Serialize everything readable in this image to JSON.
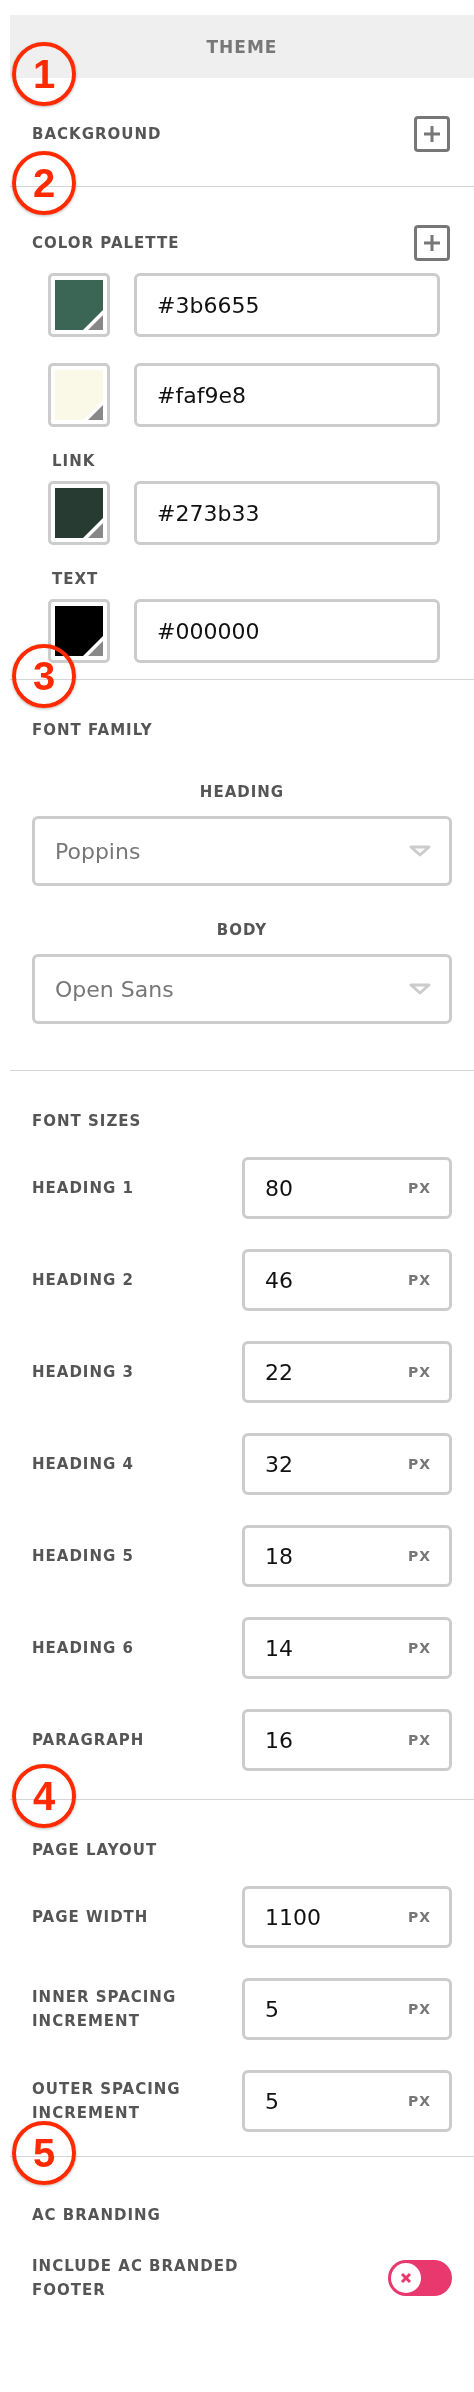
{
  "panel": {
    "title": "THEME"
  },
  "background": {
    "callout": "1",
    "label": "BACKGROUND"
  },
  "color_palette": {
    "callout": "2",
    "label": "COLOR PALETTE",
    "swatches": [
      {
        "value": "#3b6655",
        "color": "#3b6655"
      },
      {
        "value": "#faf9e8",
        "color": "#faf9e8"
      },
      {
        "label": "LINK",
        "value": "#273b33",
        "color": "#273b33"
      },
      {
        "label": "TEXT",
        "value": "#000000",
        "color": "#000000"
      }
    ]
  },
  "font_family": {
    "callout": "3",
    "label": "FONT FAMILY",
    "selects": [
      {
        "label": "HEADING",
        "value": "Poppins"
      },
      {
        "label": "BODY",
        "value": "Open Sans"
      }
    ]
  },
  "font_sizes": {
    "label": "FONT SIZES",
    "rows": [
      {
        "label": "HEADING 1",
        "value": "80",
        "unit": "PX"
      },
      {
        "label": "HEADING 2",
        "value": "46",
        "unit": "PX"
      },
      {
        "label": "HEADING 3",
        "value": "22",
        "unit": "PX"
      },
      {
        "label": "HEADING 4",
        "value": "32",
        "unit": "PX"
      },
      {
        "label": "HEADING 5",
        "value": "18",
        "unit": "PX"
      },
      {
        "label": "HEADING 6",
        "value": "14",
        "unit": "PX"
      },
      {
        "label": "PARAGRAPH",
        "value": "16",
        "unit": "PX"
      }
    ]
  },
  "page_layout": {
    "callout": "4",
    "label": "PAGE LAYOUT",
    "rows": [
      {
        "label": "PAGE WIDTH",
        "value": "1100",
        "unit": "PX"
      },
      {
        "label": "INNER SPACING INCREMENT",
        "value": "5",
        "unit": "PX"
      },
      {
        "label": "OUTER SPACING INCREMENT",
        "value": "5",
        "unit": "PX"
      }
    ]
  },
  "ac_branding": {
    "callout": "5",
    "label": "AC BRANDING",
    "toggle": {
      "label": "INCLUDE AC BRANDED FOOTER",
      "on": false
    }
  }
}
